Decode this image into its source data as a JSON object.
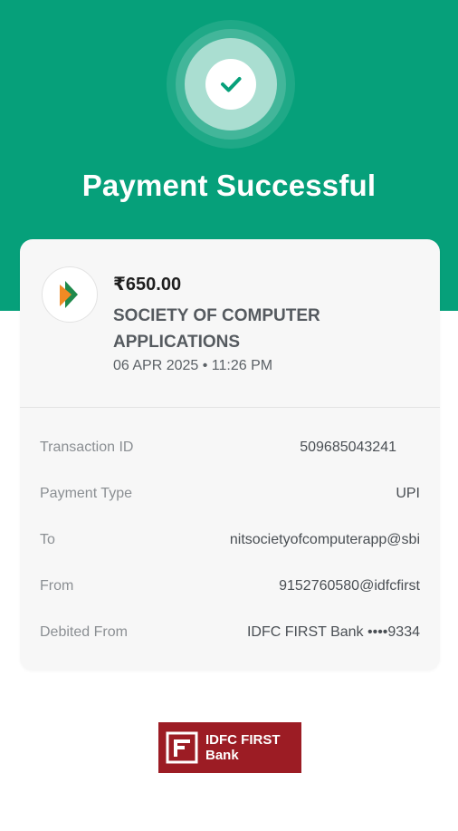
{
  "header": {
    "title": "Payment Successful",
    "status_icon": "check-icon",
    "brand_color": "#06a07a"
  },
  "payment": {
    "amount": "₹650.00",
    "payee_line1": "SOCIETY OF COMPUTER",
    "payee_line2": "APPLICATIONS",
    "datetime": "06 APR 2025 • 11:26 PM",
    "payee_logo_icon": "bhim-upi-logo-icon"
  },
  "details": [
    {
      "label": "Transaction ID",
      "value": "509685043241"
    },
    {
      "label": "Payment Type",
      "value": "UPI"
    },
    {
      "label": "To",
      "value": "nitsocietyofcomputerapp@sbi"
    },
    {
      "label": "From",
      "value": "9152760580@idfcfirst"
    },
    {
      "label": "Debited From",
      "value": "IDFC FIRST Bank ••••9334"
    }
  ],
  "footer": {
    "bank_line1": "IDFC FIRST",
    "bank_line2": "Bank",
    "bank_color": "#9c1c24"
  }
}
